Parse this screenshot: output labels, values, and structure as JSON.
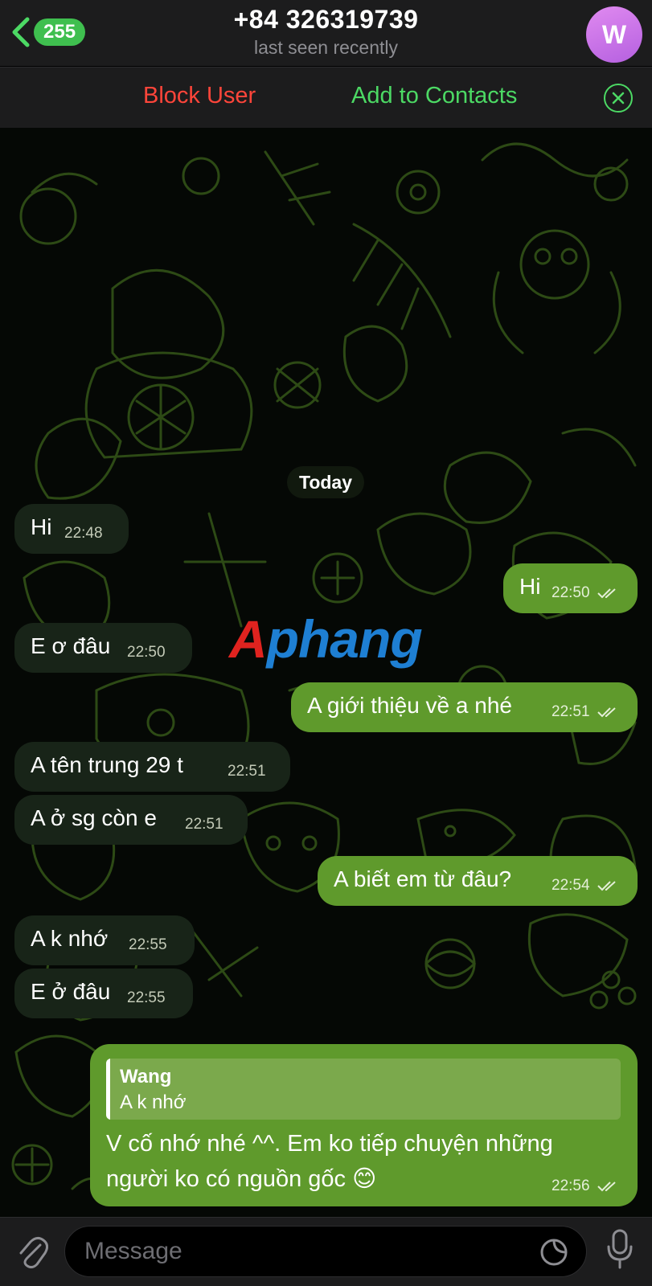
{
  "header": {
    "back_badge": "255",
    "title": "+84 326319739",
    "subtitle": "last seen recently",
    "avatar_letter": "W"
  },
  "actions": {
    "block": "Block User",
    "add": "Add to Contacts"
  },
  "chat": {
    "date": "Today",
    "messages": [
      {
        "dir": "in",
        "text": "Hi",
        "time": "22:48"
      },
      {
        "dir": "out",
        "text": "Hi",
        "time": "22:50"
      },
      {
        "dir": "in",
        "text": "E ơ đâu",
        "time": "22:50"
      },
      {
        "dir": "out",
        "text": "A giới thiệu về a nhé",
        "time": "22:51"
      },
      {
        "dir": "in",
        "text": "A tên trung 29 t",
        "time": "22:51"
      },
      {
        "dir": "in",
        "text": "A ở sg còn e",
        "time": "22:51"
      },
      {
        "dir": "out",
        "text": "A biết em từ đâu?",
        "time": "22:54"
      },
      {
        "dir": "in",
        "text": "A k nhớ",
        "time": "22:55"
      },
      {
        "dir": "in",
        "text": "E ở đâu",
        "time": "22:55"
      },
      {
        "dir": "out",
        "reply_name": "Wang",
        "reply_text": "A k nhớ",
        "text": "V cố nhớ nhé ^^. Em ko tiếp chuyện những người ko có nguồn gốc 😊",
        "time": "22:56"
      }
    ]
  },
  "watermark": {
    "part1": "A",
    "part2": "phang"
  },
  "input": {
    "placeholder": "Message"
  },
  "colors": {
    "accent": "#4cd964",
    "danger": "#ff453a",
    "outgoing": "#5f9a2c",
    "incoming": "#182418"
  }
}
